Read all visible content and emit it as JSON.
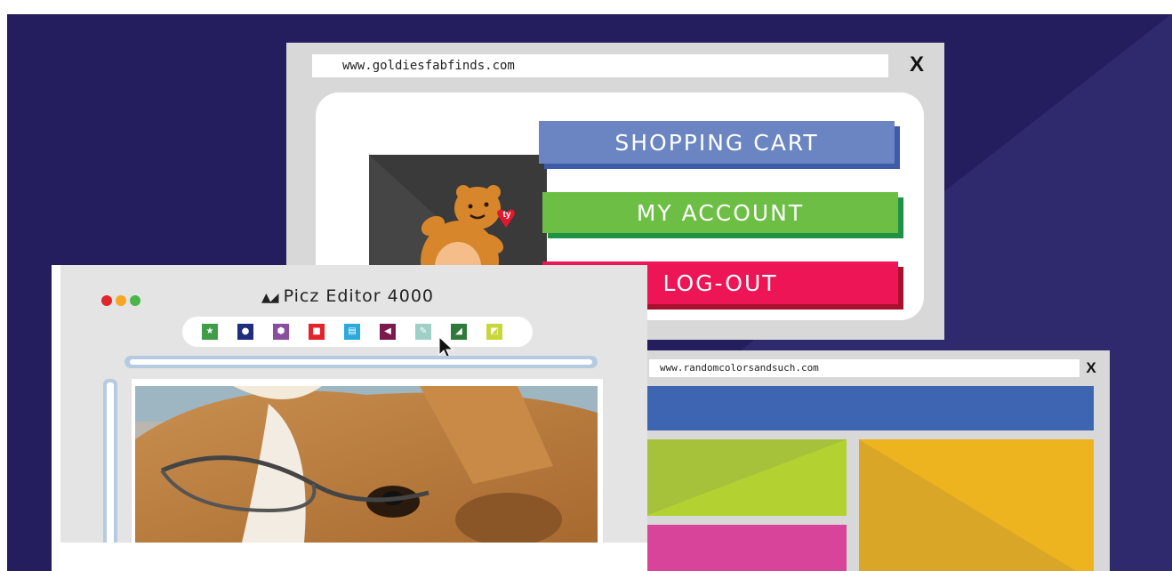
{
  "goldies_window": {
    "url": "www.goldiesfabfinds.com",
    "close_label": "X",
    "menu": [
      {
        "label": "SHOPPING CART",
        "color": "#6a85c2",
        "shadow": "#3d5ba8"
      },
      {
        "label": "MY ACCOUNT",
        "color": "#6cbf44",
        "shadow": "#1f9246"
      },
      {
        "label": "LOG-OUT",
        "color": "#ed1556",
        "shadow": "#a8102e"
      }
    ],
    "product": {
      "tag_text": "ty",
      "icon": "teddy-bear-icon"
    }
  },
  "editor_window": {
    "title": "Picz Editor 4000",
    "title_icon": "mountain-icon",
    "window_controls": [
      {
        "name": "close",
        "color": "#e0262b"
      },
      {
        "name": "minimize",
        "color": "#f6a623"
      },
      {
        "name": "maximize",
        "color": "#4ab548"
      }
    ],
    "tools": [
      {
        "name": "star-tool",
        "color": "#3f9d48",
        "glyph": "★"
      },
      {
        "name": "circle-tool",
        "color": "#1f2f7e",
        "glyph": "●"
      },
      {
        "name": "hexagon-tool",
        "color": "#8a4ea0",
        "glyph": "⬢"
      },
      {
        "name": "square-tool",
        "color": "#e42229",
        "glyph": "■"
      },
      {
        "name": "stripes-tool",
        "color": "#2aa9dd",
        "glyph": "▤"
      },
      {
        "name": "pac-tool",
        "color": "#7a1a4d",
        "glyph": "◀"
      },
      {
        "name": "pencil-tool",
        "color": "#9fd0c7",
        "glyph": "✎"
      },
      {
        "name": "leaf-tool",
        "color": "#2f7a3b",
        "glyph": "◢"
      },
      {
        "name": "fade-tool",
        "color": "#c7d63a",
        "glyph": "◩"
      }
    ],
    "hovered_tool": "pencil-tool"
  },
  "colors_window": {
    "url": "www.randomcolorsandsuch.com",
    "close_label": "X",
    "header_color": "#3e65b1",
    "blocks": [
      "#b3d232",
      "#d9a627",
      "#d84499"
    ]
  },
  "background": {
    "primary": "#241d5e",
    "secondary": "#2f2a6e"
  }
}
